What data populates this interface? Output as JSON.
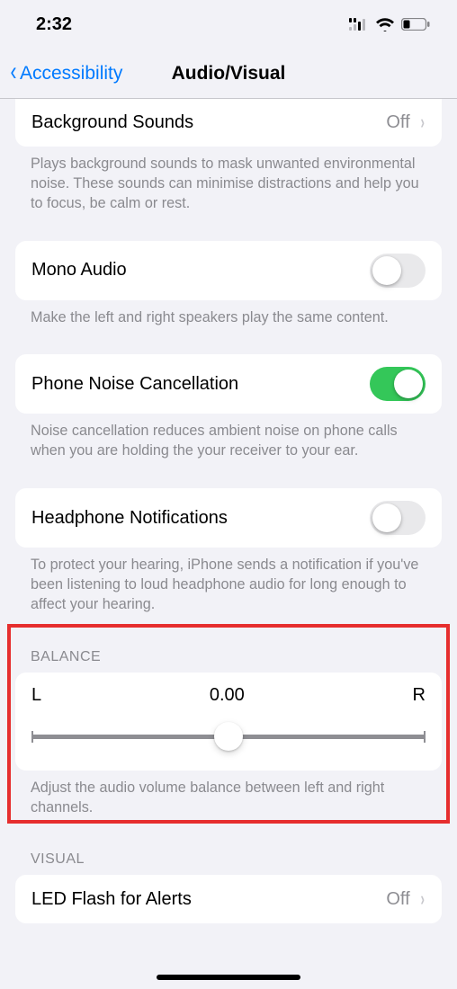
{
  "status": {
    "time": "2:32"
  },
  "nav": {
    "back": "Accessibility",
    "title": "Audio/Visual"
  },
  "bg_sounds": {
    "label": "Background Sounds",
    "value": "Off",
    "footer": "Plays background sounds to mask unwanted environmental noise. These sounds can minimise distractions and help you to focus, be calm or rest."
  },
  "mono": {
    "label": "Mono Audio",
    "footer": "Make the left and right speakers play the same content."
  },
  "noise_cancel": {
    "label": "Phone Noise Cancellation",
    "footer": "Noise cancellation reduces ambient noise on phone calls when you are holding the your receiver to your ear."
  },
  "headphone_notif": {
    "label": "Headphone Notifications",
    "footer": "To protect your hearing, iPhone sends a notification if you've been listening to loud headphone audio for long enough to affect your hearing."
  },
  "balance": {
    "header": "BALANCE",
    "left": "L",
    "value": "0.00",
    "right": "R",
    "footer": "Adjust the audio volume balance between left and right channels."
  },
  "visual": {
    "header": "VISUAL",
    "led": {
      "label": "LED Flash for Alerts",
      "value": "Off"
    }
  }
}
